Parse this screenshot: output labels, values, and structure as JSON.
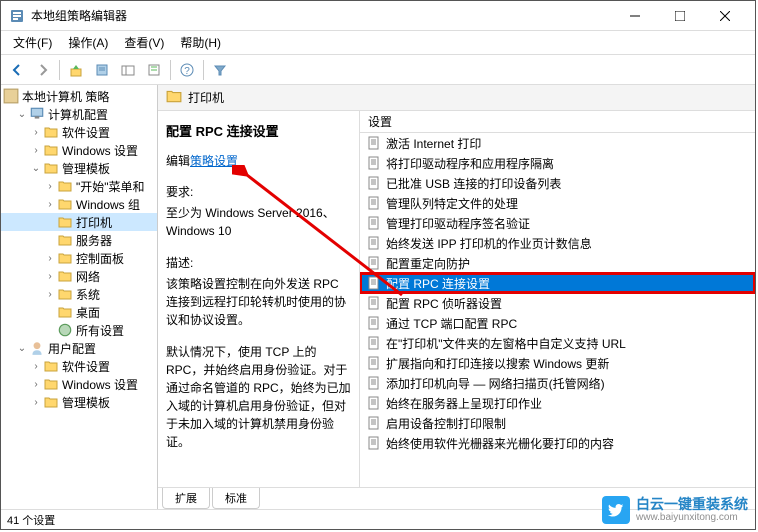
{
  "window": {
    "title": "本地组策略编辑器"
  },
  "menubar": {
    "file": "文件(F)",
    "action": "操作(A)",
    "view": "查看(V)",
    "help": "帮助(H)"
  },
  "tree": {
    "root": "本地计算机 策略",
    "computer_config": "计算机配置",
    "software_settings": "软件设置",
    "windows_settings": "Windows 设置",
    "admin_templates": "管理模板",
    "start_menu": "\"开始\"菜单和",
    "windows_components": "Windows 组",
    "printers": "打印机",
    "server": "服务器",
    "control_panel": "控制面板",
    "network": "网络",
    "system": "系统",
    "desktop": "桌面",
    "all_settings": "所有设置",
    "user_config": "用户配置",
    "user_software": "软件设置",
    "user_windows": "Windows 设置",
    "user_admin": "管理模板"
  },
  "header": {
    "title": "打印机"
  },
  "desc": {
    "title": "配置 RPC 连接设置",
    "edit_prefix": "编辑",
    "edit_link": "策略设置",
    "req_label": "要求:",
    "req_text": "至少为 Windows Server 2016、Windows 10",
    "desc_label": "描述:",
    "desc_text": "该策略设置控制在向外发送 RPC 连接到远程打印轮转机时使用的协议和协议设置。",
    "desc_text2": "默认情况下，使用 TCP 上的 RPC，并始终启用身份验证。对于通过命名管道的 RPC，始终为已加入域的计算机启用身份验证，但对于未加入域的计算机禁用身份验证。"
  },
  "list": {
    "column_header": "设置",
    "items": [
      "激活 Internet 打印",
      "将打印驱动程序和应用程序隔离",
      "已批准 USB 连接的打印设备列表",
      "管理队列特定文件的处理",
      "管理打印驱动程序签名验证",
      "始终发送 IPP 打印机的作业页计数信息",
      "配置重定向防护",
      "配置 RPC 连接设置",
      "配置 RPC 侦听器设置",
      "通过 TCP 端口配置 RPC",
      "在\"打印机\"文件夹的左窗格中自定义支持 URL",
      "扩展指向和打印连接以搜索 Windows 更新",
      "添加打印机向导 — 网络扫描页(托管网络)",
      "始终在服务器上呈现打印作业",
      "启用设备控制打印限制",
      "始终使用软件光栅器来光栅化要打印的内容"
    ],
    "selected_index": 7
  },
  "tabs": {
    "extended": "扩展",
    "standard": "标准"
  },
  "statusbar": {
    "count": "41 个设置"
  },
  "watermark": {
    "title": "白云一键重装系统",
    "url": "www.baiyunxitong.com"
  }
}
